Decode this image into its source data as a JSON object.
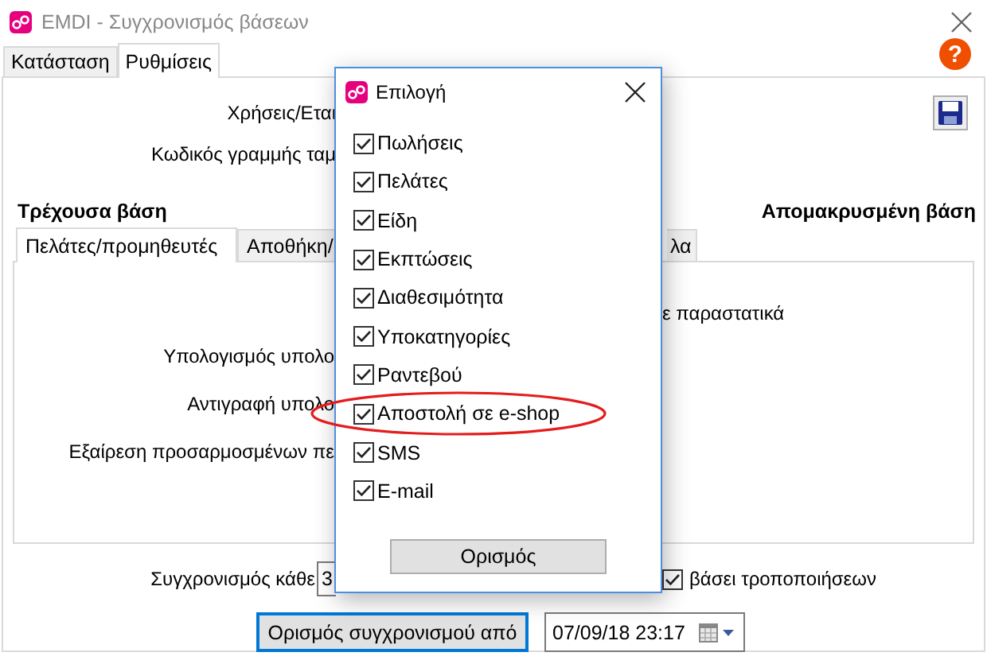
{
  "window": {
    "title": "EMDI - Συγχρονισμός βάσεων",
    "help": "?"
  },
  "tabs": [
    {
      "label": "Κατάσταση",
      "selected": false
    },
    {
      "label": "Ρυθμίσεις",
      "selected": true
    }
  ],
  "settings": {
    "rows": [
      {
        "label": "Χρήσεις/Εται"
      },
      {
        "label": "Κωδικός γραμμής ταμ"
      }
    ],
    "local_heading": "Τρέχουσα βάση",
    "remote_heading": "Απομακρυσμένη βάση",
    "sub_tabs": [
      {
        "label": "Πελάτες/προμηθευτές",
        "selected": true
      },
      {
        "label": "Αποθήκη/",
        "selected": false
      },
      {
        "label": "λα",
        "selected": false
      }
    ],
    "sub_panel": {
      "right_text": "ε παραστατικά",
      "rows": [
        "Υπολογισμός υπολο",
        "Αντιγραφή υπολο",
        "Εξαίρεση προσαρμοσμένων πε"
      ]
    },
    "sync_every": {
      "label": "Συγχρονισμός κάθε",
      "value": "3"
    },
    "on_changes": {
      "label": "βάσει τροποποιήσεων",
      "checked": true
    },
    "sync_from_button": "Ορισμός συγχρονισμού από",
    "sync_from_date": "07/09/18 23:17"
  },
  "dialog": {
    "title": "Επιλογή",
    "button": "Ορισμός",
    "options": [
      {
        "label": "Πωλήσεις",
        "checked": true,
        "highlighted": false
      },
      {
        "label": "Πελάτες",
        "checked": true,
        "highlighted": false
      },
      {
        "label": "Είδη",
        "checked": true,
        "highlighted": false
      },
      {
        "label": "Εκπτώσεις",
        "checked": true,
        "highlighted": false
      },
      {
        "label": "Διαθεσιμότητα",
        "checked": true,
        "highlighted": false
      },
      {
        "label": "Υποκατηγορίες",
        "checked": true,
        "highlighted": false
      },
      {
        "label": "Ραντεβού",
        "checked": true,
        "highlighted": false
      },
      {
        "label": "Αποστολή σε e-shop",
        "checked": true,
        "highlighted": true
      },
      {
        "label": "SMS",
        "checked": true,
        "highlighted": false
      },
      {
        "label": "E-mail",
        "checked": true,
        "highlighted": false
      }
    ]
  }
}
